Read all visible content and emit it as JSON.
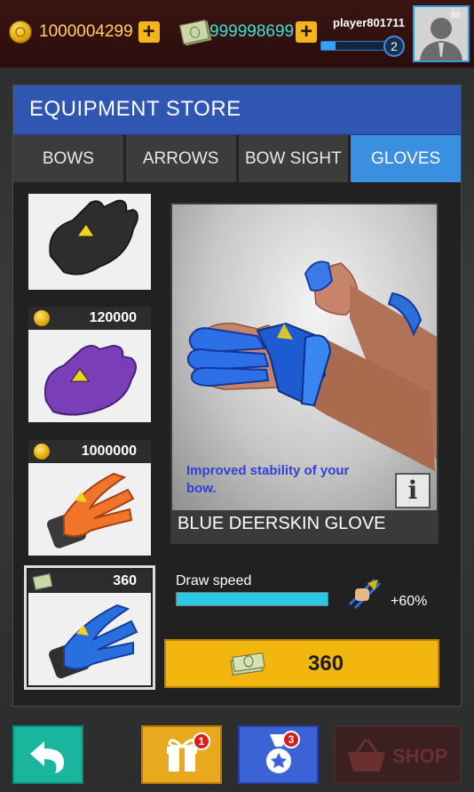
{
  "topbar": {
    "coins": "1000004299",
    "cash": "999998699",
    "plus": "+",
    "player_name": "player801711",
    "level": "2",
    "xp_fraction": 0.18
  },
  "store": {
    "title": "EQUIPMENT STORE",
    "tabs": [
      {
        "label": "BOWS"
      },
      {
        "label": "ARROWS"
      },
      {
        "label": "BOW SIGHT"
      },
      {
        "label": "GLOVES"
      }
    ],
    "active_tab": "GLOVES",
    "items": [
      {
        "price": "",
        "currency": "none",
        "color": "#2d2d2d"
      },
      {
        "price": "120000",
        "currency": "coin",
        "color": "#7a3fb8"
      },
      {
        "price": "1000000",
        "currency": "coin",
        "color": "#f0742a"
      },
      {
        "price": "360",
        "currency": "cash",
        "color": "#2a6fe0",
        "selected": true
      }
    ]
  },
  "detail": {
    "description": "Improved stability of your bow.",
    "info_icon": "i",
    "name": "BLUE DEERSKIN GLOVE",
    "stat_label": "Draw speed",
    "stat_fraction": 1.0,
    "stat_bonus": "+60%",
    "buy_price": "360"
  },
  "bottom": {
    "gift_badge": "1",
    "medal_badge": "3",
    "shop_label": "SHOP"
  },
  "colors": {
    "header_blue": "#2f56b3",
    "tab_active": "#3a8fe0",
    "buy_yellow": "#f2b60f",
    "stat_cyan": "#29c9e6"
  }
}
